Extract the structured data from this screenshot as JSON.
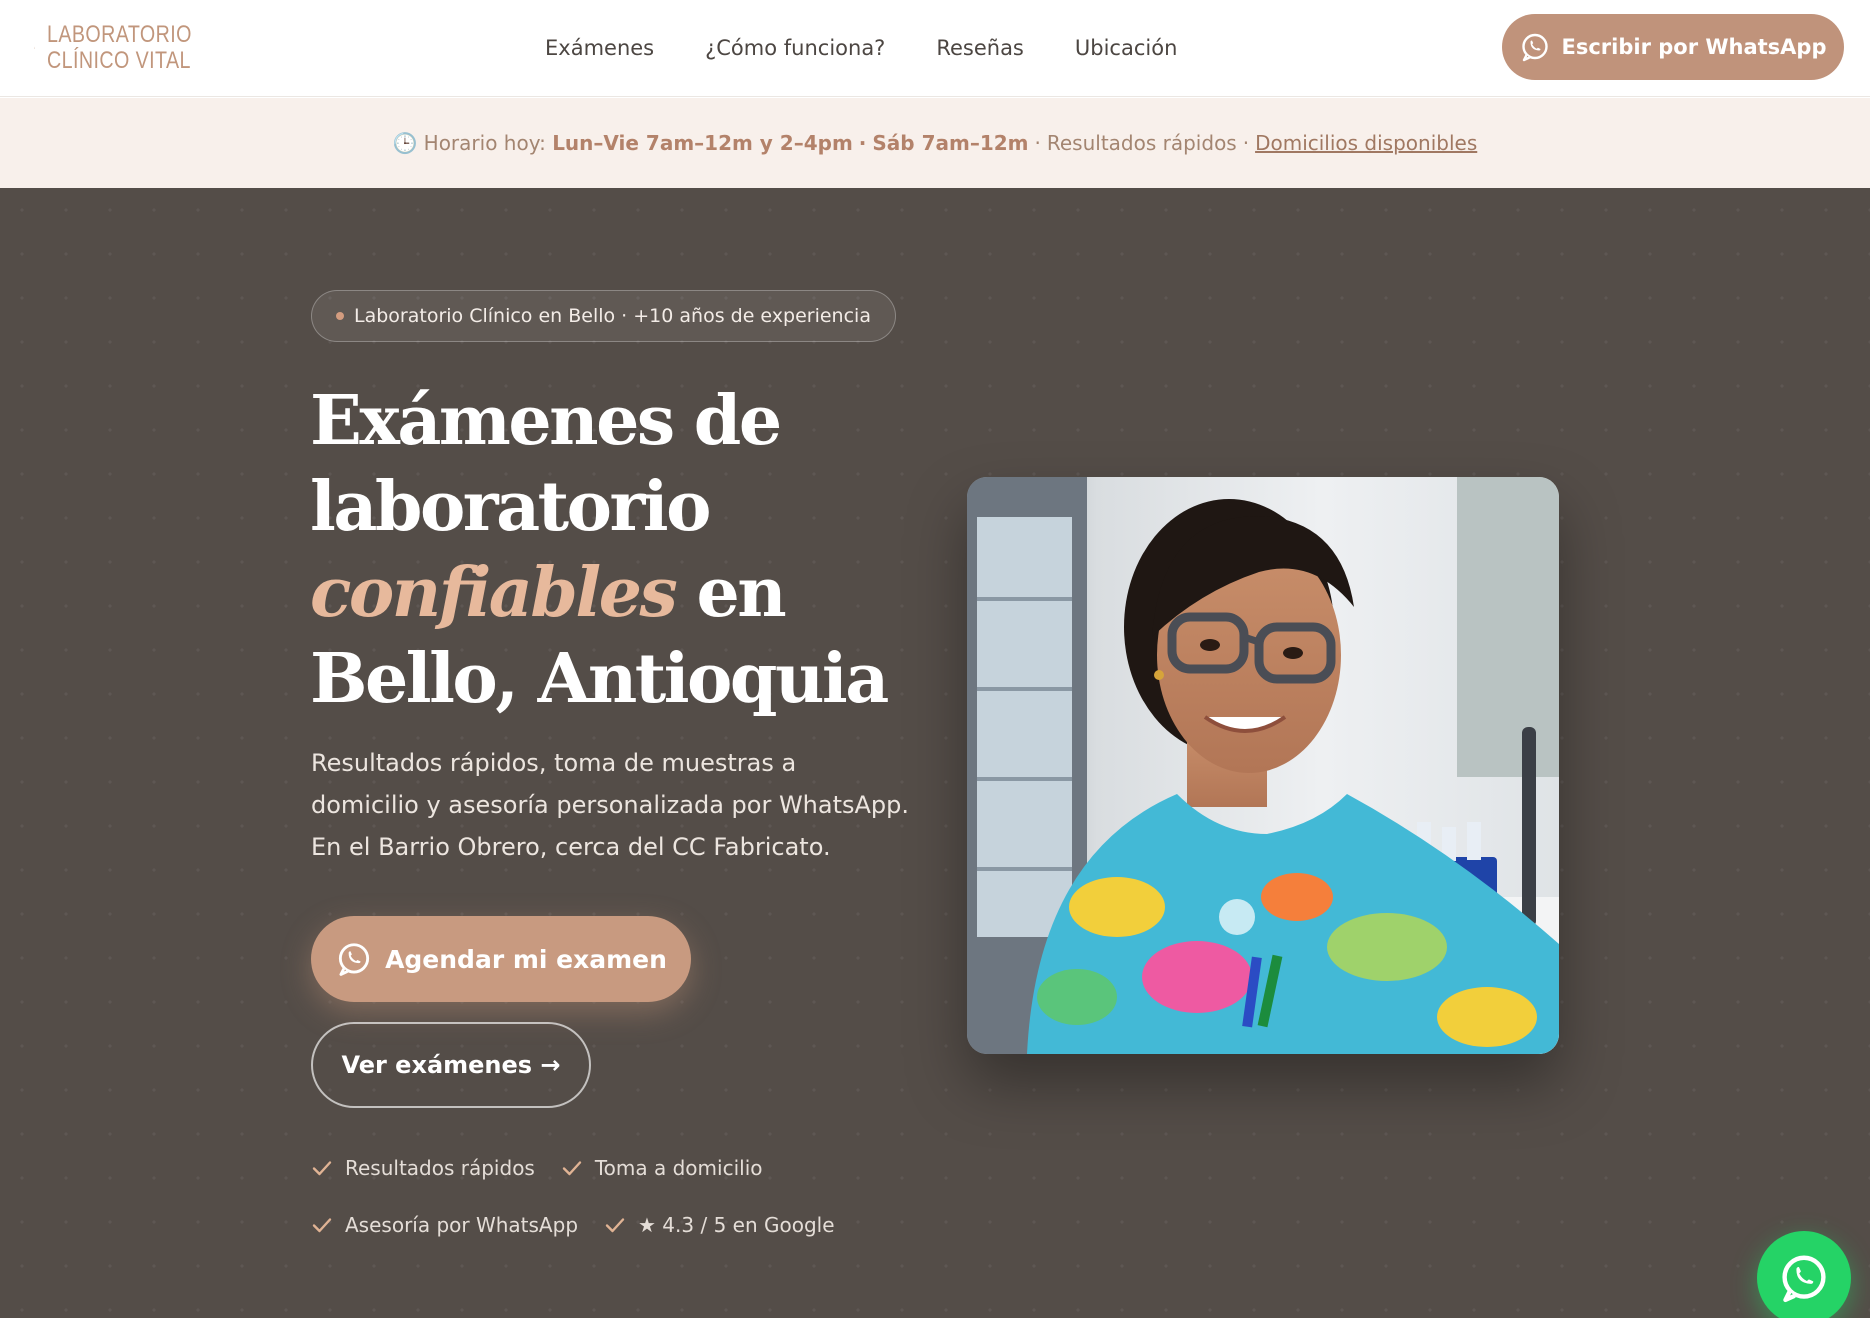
{
  "brand": {
    "line1": "LABORATORIO",
    "line2": "CLÍNICO VITAL",
    "color": "#c1967c"
  },
  "nav": {
    "items": [
      "Exámenes",
      "¿Cómo funciona?",
      "Reseñas",
      "Ubicación"
    ]
  },
  "header": {
    "whatsapp_label": "Escribir por WhatsApp",
    "whatsapp_icon": "whatsapp-icon"
  },
  "hours": {
    "icon": "clock-icon",
    "prefix": "Horario hoy:",
    "weekday": "Lun–Vie 7am–12m y 2–4pm",
    "saturday": "Sáb 7am–12m",
    "fast": "Resultados rápidos",
    "link": "Domicilios disponibles"
  },
  "hero": {
    "pill": "Laboratorio Clínico en Bello · +10 años de experiencia",
    "title_line1": "Exámenes de",
    "title_line2": "laboratorio",
    "title_accent": "confiables",
    "title_line3_rest": " en",
    "title_line4": "Bello, Antioquia",
    "subtitle": "Resultados rápidos, toma de muestras a domicilio y asesoría personalizada por WhatsApp. En el Barrio Obrero, cerca del CC Fabricato.",
    "cta_primary": "Agendar mi examen",
    "cta_secondary": "Ver exámenes →",
    "features": [
      "Resultados rápidos",
      "Toma a domicilio",
      "Asesoría por WhatsApp",
      "★ 4.3 / 5 en Google"
    ],
    "background_color": "#544d48",
    "accent_color": "#e7b99c",
    "button_color": "#c89a80"
  },
  "floating": {
    "icon": "whatsapp-icon",
    "color": "#25d366"
  }
}
